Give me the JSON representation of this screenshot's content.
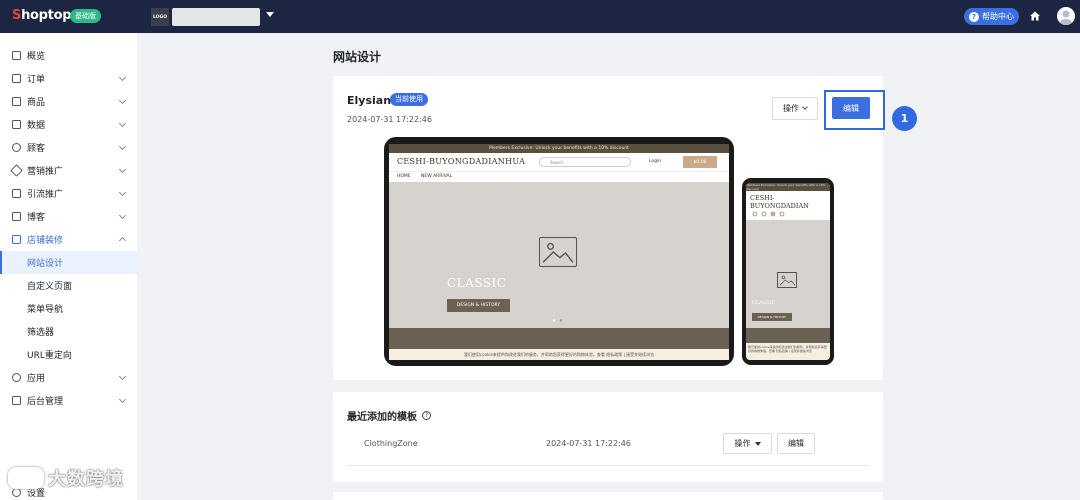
{
  "topbar": {
    "logo_prefix": "S",
    "logo_rest": "hoptop",
    "plan_badge": "基础版",
    "store_logo_text": "LOGO",
    "help_label": "帮助中心"
  },
  "sidebar": {
    "items": [
      {
        "label": "概览",
        "icon": "dashboard-icon"
      },
      {
        "label": "订单",
        "icon": "order-icon"
      },
      {
        "label": "商品",
        "icon": "product-icon"
      },
      {
        "label": "数据",
        "icon": "data-icon"
      },
      {
        "label": "顾客",
        "icon": "customer-icon"
      },
      {
        "label": "营销推广",
        "icon": "tag-icon"
      },
      {
        "label": "引流推广",
        "icon": "traffic-icon"
      },
      {
        "label": "博客",
        "icon": "blog-icon"
      },
      {
        "label": "店铺装修",
        "icon": "store-icon"
      }
    ],
    "sub_items": [
      "网站设计",
      "自定义页面",
      "菜单导航",
      "筛选器",
      "URL重定向"
    ],
    "after_items": [
      {
        "label": "应用",
        "icon": "app-icon"
      },
      {
        "label": "后台管理",
        "icon": "folder-icon"
      },
      {
        "label": "设置",
        "icon": "settings-icon"
      }
    ]
  },
  "watermark": "大数跨境",
  "main": {
    "page_title": "网站设计",
    "current_theme": {
      "name": "Elysian",
      "badge": "当前使用",
      "date": "2024-07-31 17:22:46",
      "ops_label": "操作",
      "edit_label": "编辑"
    },
    "step_number": "1",
    "preview": {
      "announcement": "Members Exclusive: Unlock your benefits with a 10% discount",
      "brand": "CESHI-BUYONGDADIANHUA",
      "brand_mobile": "CESHI-BUYONGDADIAN",
      "search_placeholder": "Search",
      "login": "Login",
      "cart": "$0.00",
      "nav_home": "HOME",
      "nav_new": "NEW ARRIVAL",
      "hero_title": "CLASSIC",
      "hero_button": "DESIGN & HISTORY",
      "cookie_text": "我们使用cookie来提供和改进我们的服务，并帮助您获得更好的购物体验。查看 隐私政策 | 接受并继续浏览"
    },
    "recent": {
      "title": "最近添加的模板",
      "rows": [
        {
          "name": "ClothingZone",
          "date": "2024-07-31 17:22:46",
          "ops_label": "操作",
          "edit_label": "编辑"
        }
      ]
    }
  }
}
